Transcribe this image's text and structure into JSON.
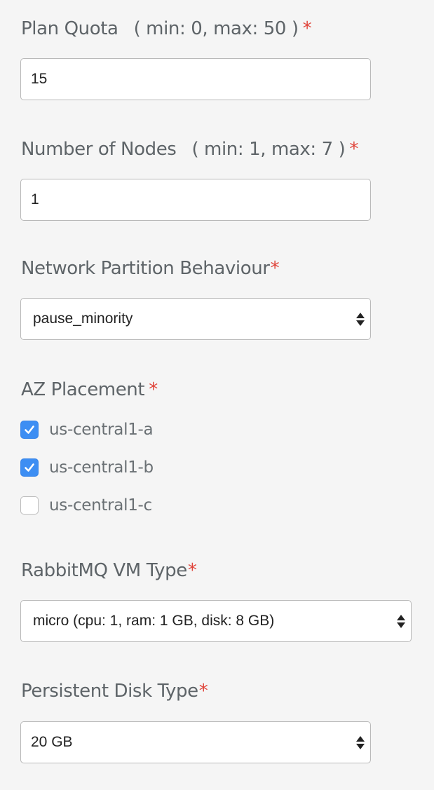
{
  "plan_quota": {
    "label": "Plan Quota",
    "hint": "( min: 0, max: 50 )",
    "required_mark": "*",
    "value": "15"
  },
  "number_of_nodes": {
    "label": "Number of Nodes",
    "hint": "( min: 1, max: 7 )",
    "required_mark": "*",
    "value": "1"
  },
  "network_partition": {
    "label": "Network Partition Behaviour",
    "required_mark": "*",
    "selected": "pause_minority"
  },
  "az_placement": {
    "label": "AZ Placement",
    "required_mark": "*",
    "options": [
      {
        "label": "us-central1-a",
        "checked": true
      },
      {
        "label": "us-central1-b",
        "checked": true
      },
      {
        "label": "us-central1-c",
        "checked": false
      }
    ]
  },
  "vm_type": {
    "label": "RabbitMQ VM Type",
    "required_mark": "*",
    "selected": "micro (cpu: 1, ram: 1 GB, disk: 8 GB)"
  },
  "disk_type": {
    "label": "Persistent Disk Type",
    "required_mark": "*",
    "selected": "20 GB"
  },
  "colors": {
    "checkbox_checked": "#3d8ef3",
    "required": "#e0443a",
    "label_text": "#5e6468"
  },
  "icons": {
    "select_arrows": "up-down-arrows-icon",
    "checkmark": "checkmark-icon"
  }
}
